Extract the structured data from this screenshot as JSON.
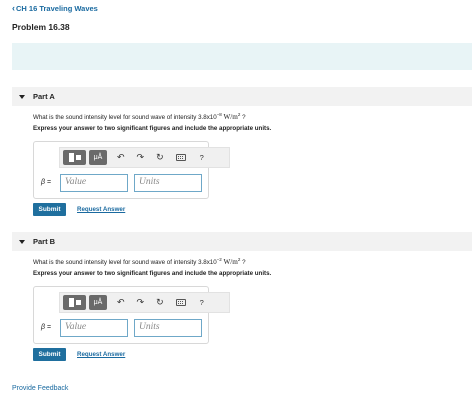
{
  "nav": {
    "back_chevron": "‹",
    "back_label": "CH 16 Traveling Waves"
  },
  "page": {
    "title": "Problem 16.38"
  },
  "parts": [
    {
      "label": "Part A",
      "question_prefix": "What is the sound intensity level for sound wave of intensity 3.8x10",
      "exponent": "−8",
      "unit_text": " W/m",
      "unit_exp": "2",
      "question_suffix": " ?",
      "instruction": "Express your answer to two significant figures and include the appropriate units.",
      "beta_symbol": "β",
      "beta_eq": " =",
      "value_placeholder": "Value",
      "units_placeholder": "Units",
      "submit_label": "Submit",
      "request_label": "Request Answer"
    },
    {
      "label": "Part B",
      "question_prefix": "What is the sound intensity level for sound wave of intensity 3.8x10",
      "exponent": "−2",
      "unit_text": " W/m",
      "unit_exp": "2",
      "question_suffix": " ?",
      "instruction": "Express your answer to two significant figures and include the appropriate units.",
      "beta_symbol": "β",
      "beta_eq": " =",
      "value_placeholder": "Value",
      "units_placeholder": "Units",
      "submit_label": "Submit",
      "request_label": "Request Answer"
    }
  ],
  "toolbar": {
    "units_label": "μÅ",
    "undo": "↶",
    "redo": "↷",
    "reset": "↻",
    "help": "?"
  },
  "footer": {
    "feedback_label": "Provide Feedback"
  },
  "colors": {
    "link": "#1a6aa0",
    "submit": "#1f6f9e",
    "banner": "#e8f4f6",
    "input_border": "#6fa8c8"
  },
  "icons": [
    "chevron-left-icon",
    "triangle-down-icon",
    "templates-icon",
    "units-icon",
    "undo-icon",
    "redo-icon",
    "reset-icon",
    "keyboard-icon",
    "help-icon"
  ]
}
